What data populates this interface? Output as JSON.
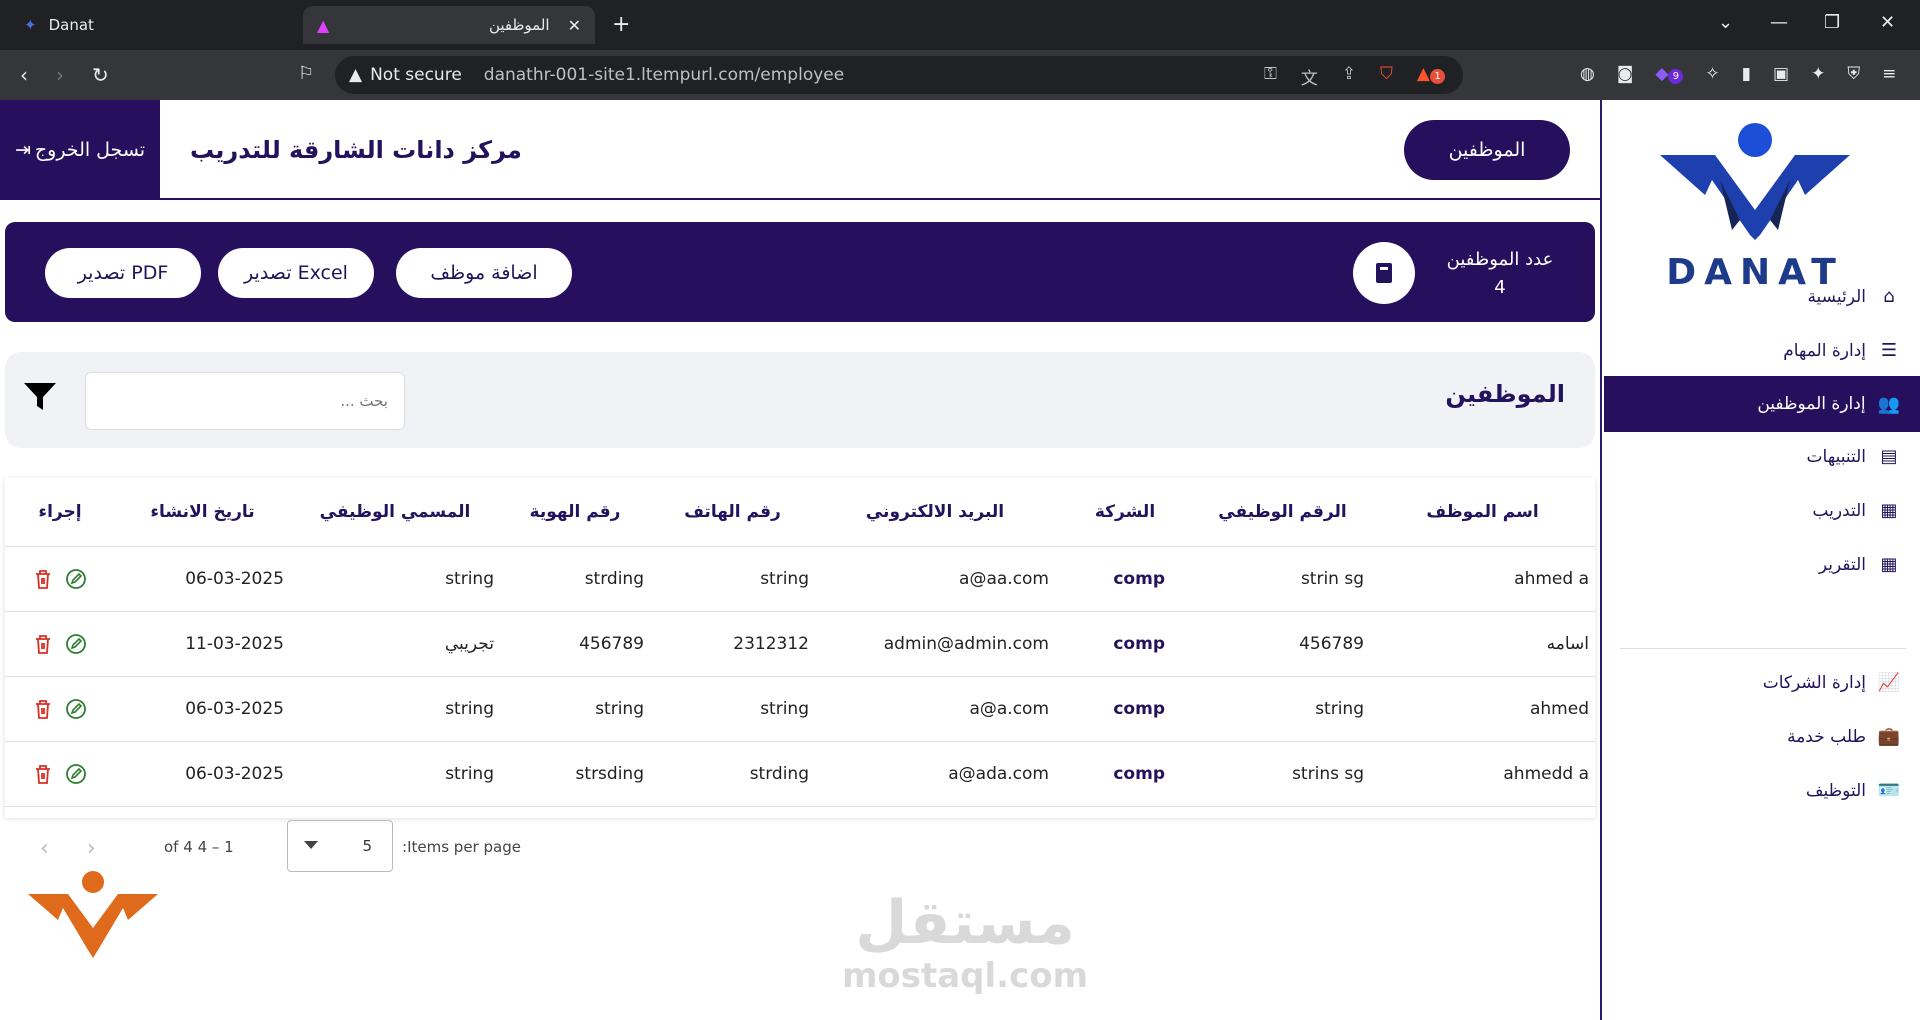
{
  "browser": {
    "tab1_title": "Danat",
    "tab2_title": "الموظفين",
    "not_secure": "Not secure",
    "url": "danathr-001-site1.ltempurl.com/employee",
    "ext_badge_1": "1",
    "ext_badge_9": "9"
  },
  "header": {
    "logout": "تسجل الخروج",
    "center_title": "مركز دانات الشارقة للتدريب",
    "employees_pill": "الموظفين"
  },
  "banner": {
    "export_pdf": "تصدير PDF",
    "export_excel": "تصدير Excel",
    "add_employee": "اضافة موظف",
    "count_label": "عدد الموظفين",
    "count_value": "4"
  },
  "filter": {
    "search_placeholder": "بحث ...",
    "title": "الموظفين"
  },
  "table": {
    "headers": [
      "إجراء",
      "تاريخ الانشاء",
      "المسمي الوظيفي",
      "رقم الهوية",
      "رقم الهاتف",
      "البريد الالكتروني",
      "الشركة",
      "الرقم الوظيفي",
      "اسم الموظف"
    ],
    "rows": [
      {
        "date": "06-03-2025",
        "title": "string",
        "id": "strding",
        "phone": "string",
        "email": "a@aa.com",
        "company": "comp",
        "emp_no": "strin sg",
        "name": "ahmed a"
      },
      {
        "date": "11-03-2025",
        "title": "تجريبي",
        "id": "456789",
        "phone": "2312312",
        "email": "admin@admin.com",
        "company": "comp",
        "emp_no": "456789",
        "name": "اسامه"
      },
      {
        "date": "06-03-2025",
        "title": "string",
        "id": "string",
        "phone": "string",
        "email": "a@a.com",
        "company": "comp",
        "emp_no": "string",
        "name": "ahmed"
      },
      {
        "date": "06-03-2025",
        "title": "string",
        "id": "strsding",
        "phone": "strding",
        "email": "a@ada.com",
        "company": "comp",
        "emp_no": "strins sg",
        "name": "ahmedd a"
      }
    ]
  },
  "pager": {
    "range": "1 – 4 of 4",
    "page_size": "5",
    "items_per_page": "Items per page:"
  },
  "sidebar": {
    "logo_text": "DANAT",
    "items": [
      {
        "label": "الرئيسية",
        "icon": "home-icon"
      },
      {
        "label": "إدارة المهام",
        "icon": "tasks-icon"
      },
      {
        "label": "إدارة الموظفين",
        "icon": "users-icon"
      },
      {
        "label": "التنبيهات",
        "icon": "document-icon"
      },
      {
        "label": "التدريب",
        "icon": "chart-icon"
      },
      {
        "label": "التقرير",
        "icon": "chart-icon"
      },
      {
        "label": "إدارة الشركات",
        "icon": "line-chart-icon"
      },
      {
        "label": "طلب خدمة",
        "icon": "briefcase-icon"
      },
      {
        "label": "التوظيف",
        "icon": "id-card-icon"
      }
    ]
  },
  "watermark": {
    "ar": "مستقل",
    "en": "mostaql.com"
  },
  "colors": {
    "primary": "#26105e",
    "danger": "#d93025",
    "success": "#2e7d32",
    "logo_blue": "#1e3a8a",
    "logo_orange": "#e06a1b"
  }
}
